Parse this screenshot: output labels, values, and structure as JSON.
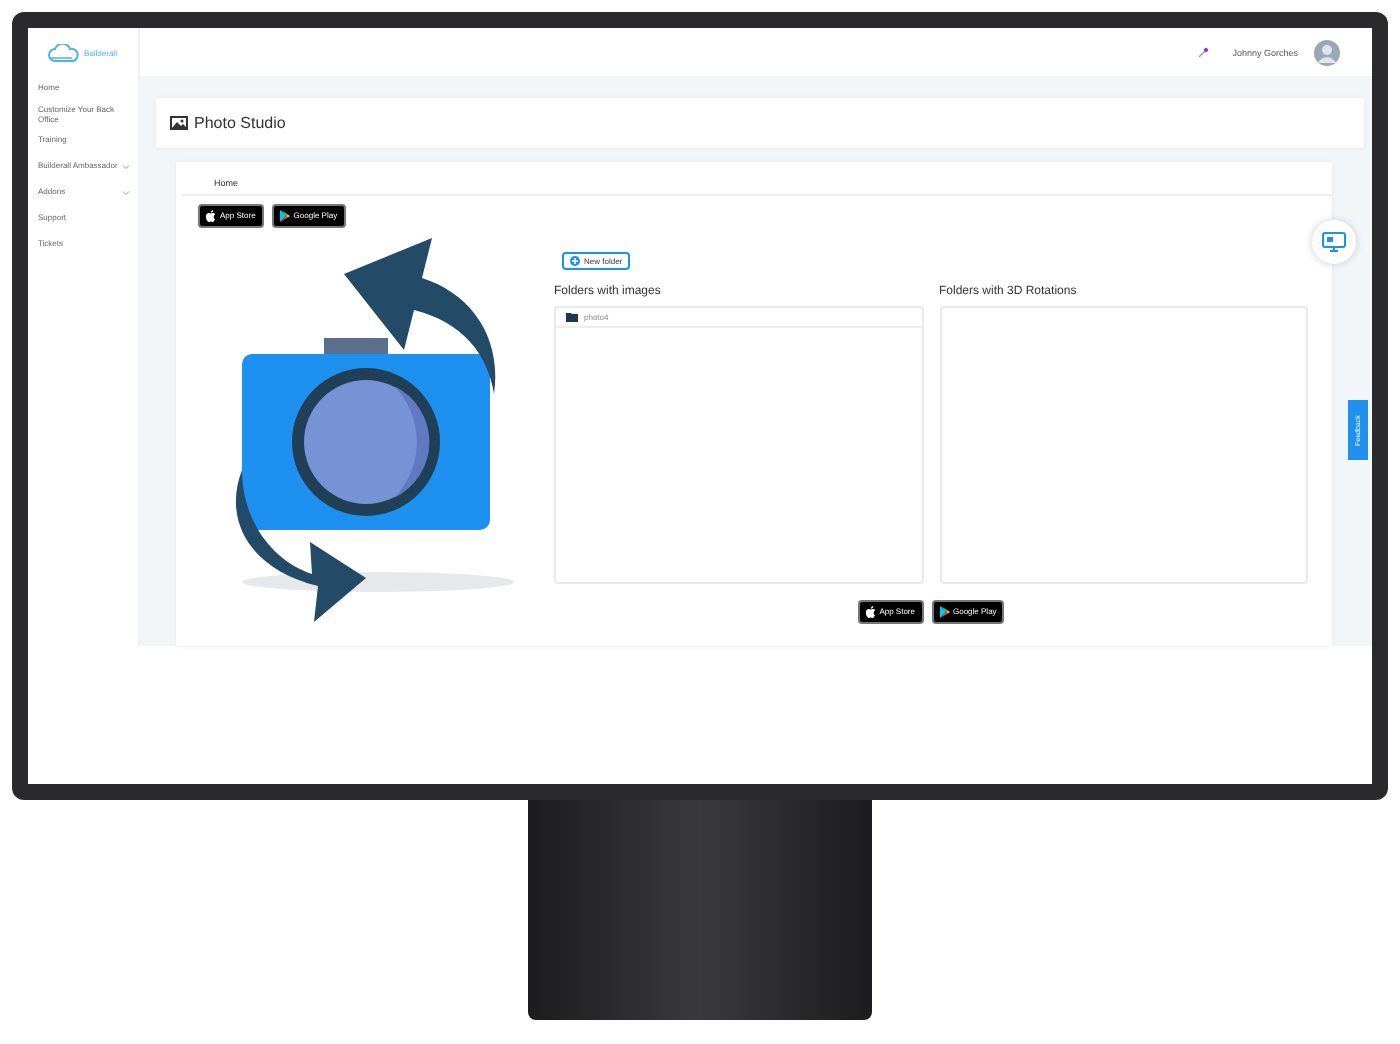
{
  "brand": {
    "name": "Builderall"
  },
  "sidebar": {
    "items": [
      {
        "label": "Home",
        "expandable": false
      },
      {
        "label": "Customize Your Back Office",
        "expandable": false
      },
      {
        "label": "Training",
        "expandable": false
      },
      {
        "label": "Builderall Ambassador",
        "expandable": true
      },
      {
        "label": "Addons",
        "expandable": true
      },
      {
        "label": "Support",
        "expandable": false
      },
      {
        "label": "Tickets",
        "expandable": false
      }
    ]
  },
  "header": {
    "user_name": "Johnny Gorches"
  },
  "page_title": "Photo Studio",
  "breadcrumb": "Home",
  "store_badges": [
    {
      "kind": "apple",
      "big": "App Store"
    },
    {
      "kind": "google",
      "big": "Google Play"
    }
  ],
  "new_folder_button": "New folder",
  "panels": [
    {
      "title": "Folders with images",
      "folders": [
        "photo4"
      ]
    },
    {
      "title": "Folders with 3D Rotations"
    }
  ],
  "bottom_badges": [
    {
      "kind": "apple",
      "big": "App Store"
    },
    {
      "kind": "google",
      "big": "Google Play"
    }
  ],
  "feedback_tab": "Feedback"
}
